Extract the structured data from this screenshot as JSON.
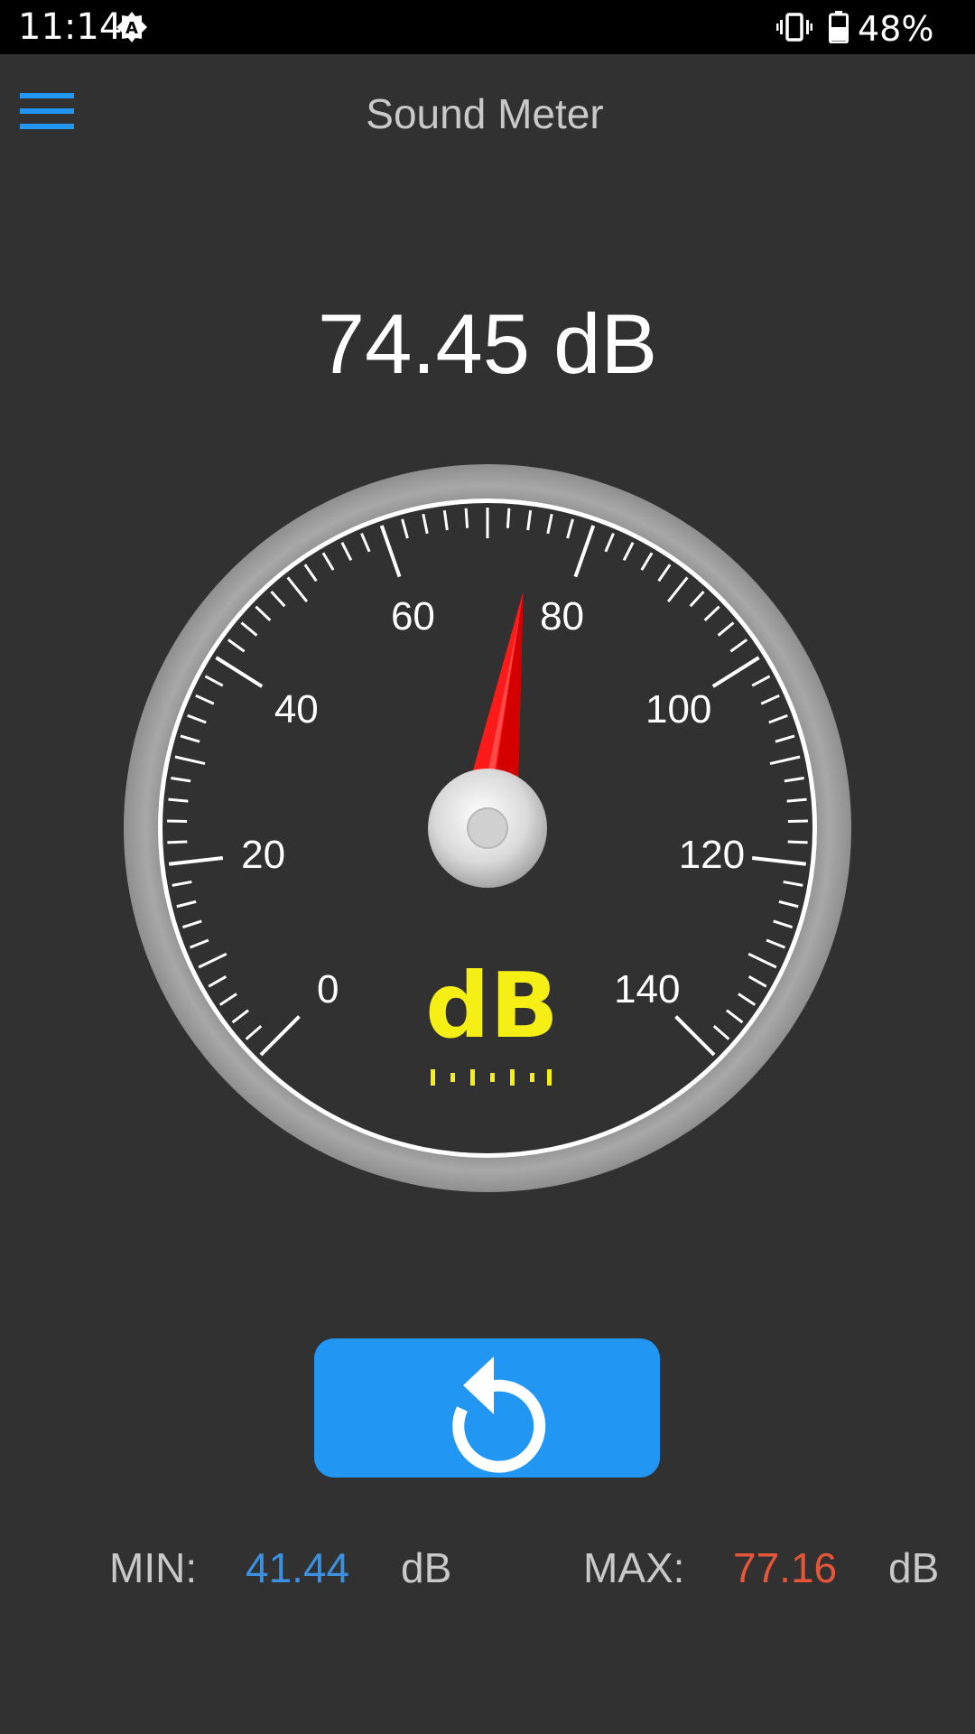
{
  "status_bar": {
    "time": "11:14",
    "battery": "48%",
    "icons": [
      "auto-brightness-icon",
      "vibrate-icon",
      "battery-icon"
    ]
  },
  "header": {
    "title": "Sound Meter",
    "menu_icon": "hamburger-menu-icon"
  },
  "meter": {
    "reading_text": "74.45 dB",
    "value": 74.45,
    "unit_label": "dB",
    "scale_min": 0,
    "scale_max": 140,
    "scale_labels": [
      "0",
      "20",
      "40",
      "60",
      "80",
      "100",
      "120",
      "140"
    ]
  },
  "reset_button": {
    "icon": "reset-icon"
  },
  "stats": {
    "min_label": "MIN:",
    "min_value": "41.44",
    "min_unit": "dB",
    "max_label": "MAX:",
    "max_value": "77.16",
    "max_unit": "dB"
  },
  "colors": {
    "background": "#313131",
    "accent": "#2196f3",
    "min_value": "#3d8fe0",
    "max_value": "#e8563a",
    "needle": "#ff1a1a",
    "unit_label": "#f6ef15"
  }
}
